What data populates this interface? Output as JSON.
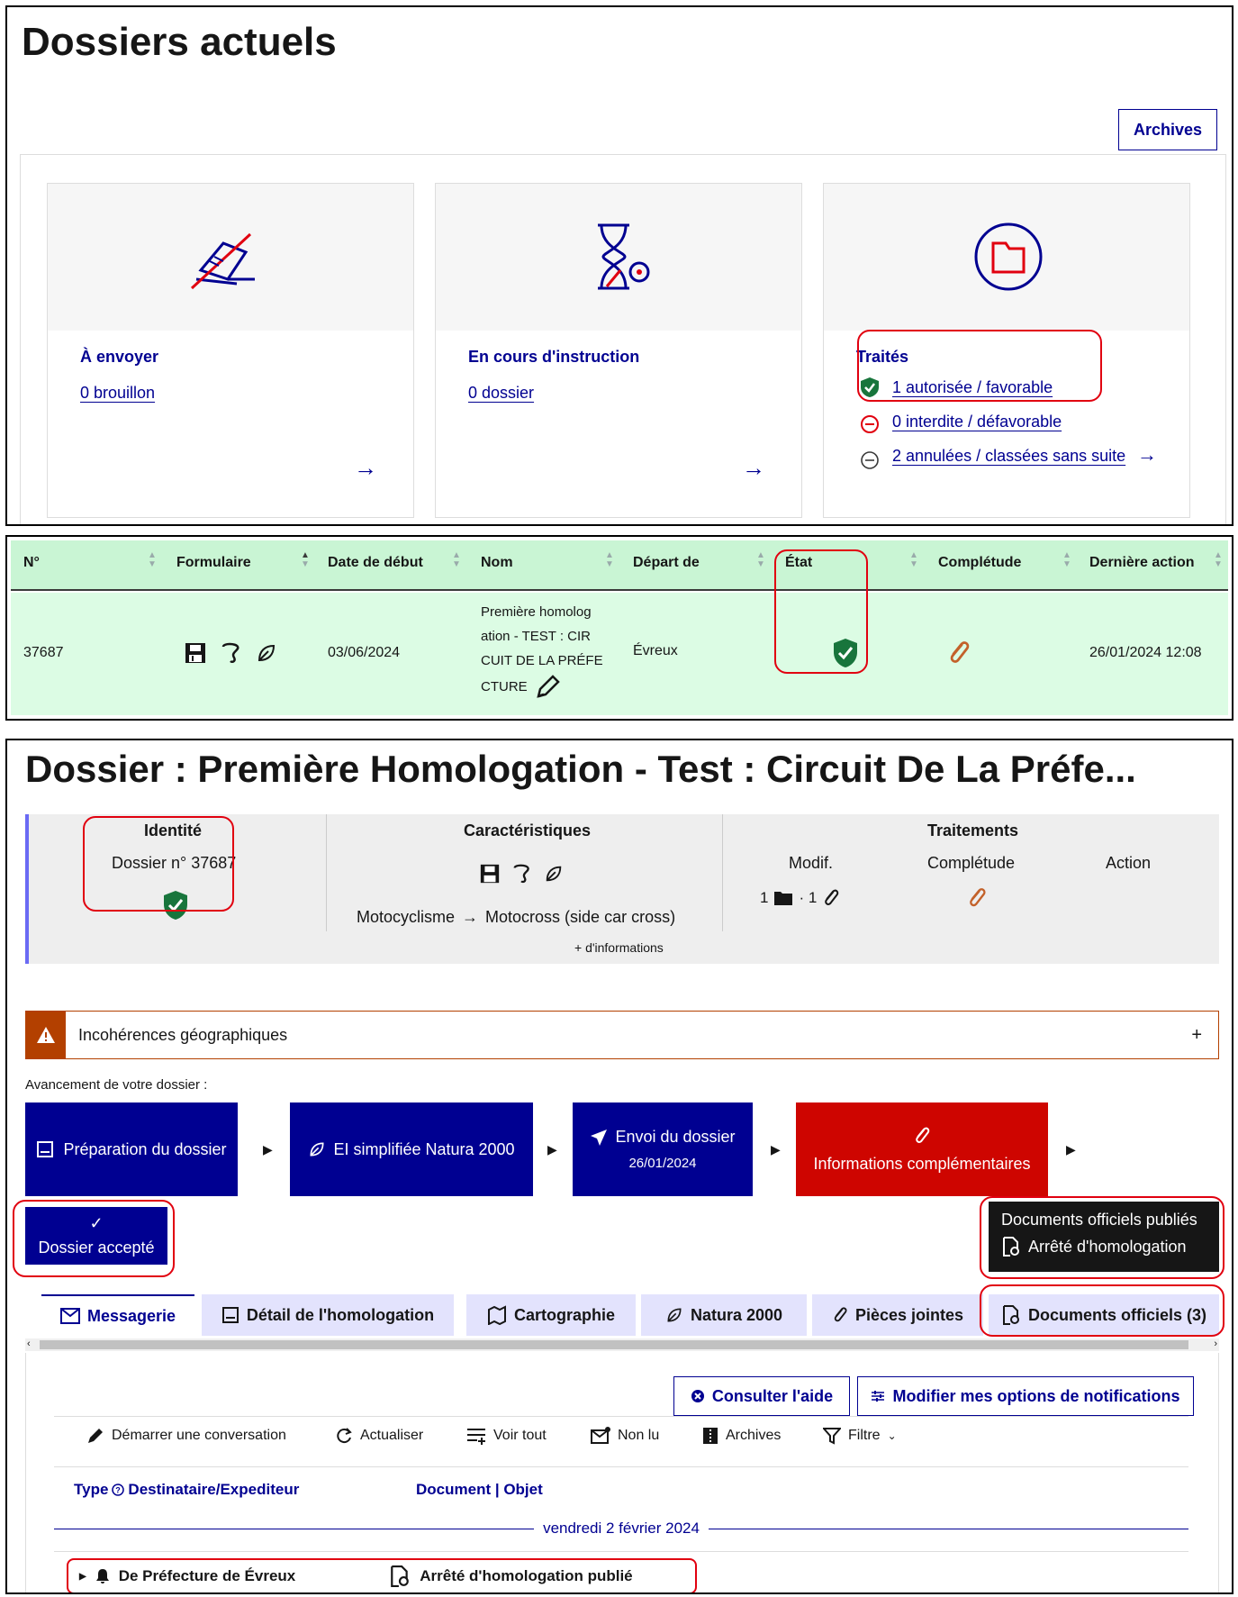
{
  "panel1": {
    "title": "Dossiers actuels",
    "archives_button": "Archives",
    "cards": [
      {
        "title": "À envoyer",
        "link": "0 brouillon",
        "arrow": "→"
      },
      {
        "title": "En cours d'instruction",
        "link": "0 dossier",
        "arrow": "→"
      },
      {
        "title": "Traités",
        "links": [
          "1 autorisée / favorable",
          "0 interdite / défavorable",
          "2 annulées / classées sans suite"
        ],
        "arrow": "→"
      }
    ]
  },
  "table": {
    "headers": [
      "N°",
      "Formulaire",
      "Date de début",
      "Nom",
      "Départ de",
      "État",
      "Complétude",
      "Dernière action"
    ],
    "row": {
      "num": "37687",
      "date": "03/06/2024",
      "name_lines": [
        "Première homolog",
        "ation - TEST : CIR",
        "CUIT DE LA PRÉFE",
        "CTURE"
      ],
      "depart": "Évreux",
      "last_action": "26/01/2024 12:08"
    }
  },
  "dossier": {
    "title": "Dossier : Première Homologation - Test : Circuit De La Préfe...",
    "identite": {
      "title": "Identité",
      "value": "Dossier n° 37687"
    },
    "caracteristiques": {
      "title": "Caractéristiques",
      "path_from": "Motocyclisme",
      "path_to": "Motocross (side car cross)",
      "more": "+ d'informations"
    },
    "traitements": {
      "title": "Traitements",
      "col1": "Modif.",
      "col2": "Complétude",
      "col3": "Action",
      "modif_a": "1",
      "modif_b": "· 1"
    },
    "alert": {
      "label": "Incohérences géographiques",
      "toggle": "+"
    },
    "progress_label": "Avancement de votre dossier :",
    "steps": [
      "Préparation du dossier",
      "EI simplifiée Natura 2000",
      "Envoi du dossier",
      "26/01/2024",
      "Informations complémentaires",
      "Dossier accepté"
    ],
    "docs_box": {
      "title": "Documents officiels publiés",
      "item": "Arrêté d'homologation"
    },
    "tabs": [
      "Messagerie",
      "Détail de l'homologation",
      "Cartographie",
      "Natura 2000",
      "Pièces jointes",
      "Documents officiels (3)"
    ],
    "buttons": {
      "help": "Consulter l'aide",
      "notif": "Modifier mes options de notifications"
    },
    "toolbar": [
      "Démarrer une conversation",
      "Actualiser",
      "Voir tout",
      "Non lu",
      "Archives",
      "Filtre"
    ],
    "columns": {
      "type": "Type",
      "dest": "Destinataire/Expediteur",
      "doc": "Document | Objet"
    },
    "date_sep": "vendredi 2 février 2024",
    "message": {
      "from": "De Préfecture de Évreux",
      "subject": "Arrêté d'homologation publié"
    }
  },
  "colors": {
    "blue": "#000091",
    "red": "#e1000f",
    "green": "#18753c",
    "orange": "#c3612a",
    "table_head": "#c9f5d4",
    "table_row": "#dcfce4"
  }
}
